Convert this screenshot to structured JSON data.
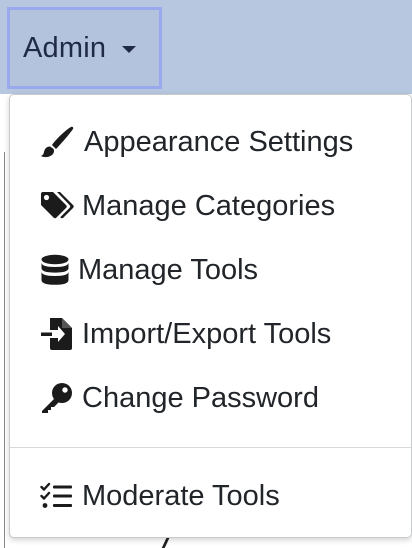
{
  "header": {
    "admin_label": "Admin",
    "admin_toggle_icon": "caret-down-icon"
  },
  "menu": {
    "items": [
      {
        "label": "Appearance Settings",
        "icon": "paint-brush-icon"
      },
      {
        "label": "Manage Categories",
        "icon": "tags-icon"
      },
      {
        "label": "Manage Tools",
        "icon": "database-icon"
      },
      {
        "label": "Import/Export Tools",
        "icon": "file-import-icon"
      },
      {
        "label": "Change Password",
        "icon": "key-icon"
      },
      {
        "label": "Moderate Tools",
        "icon": "tasks-checklist-icon"
      }
    ]
  },
  "colors": {
    "topbar_bg": "#b7c7df",
    "toggle_border": "#9aa8ee",
    "text": "#212529",
    "icon": "#1b1b1b"
  }
}
